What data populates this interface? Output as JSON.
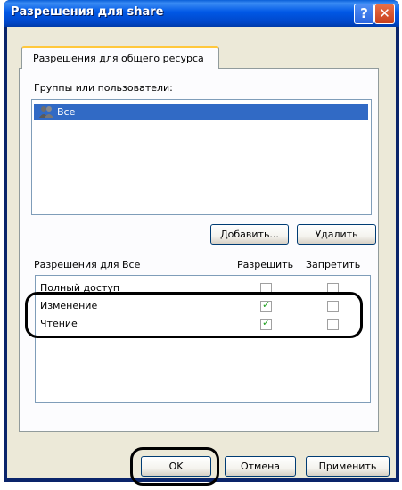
{
  "window": {
    "title": "Разрешения для share"
  },
  "tabs": [
    {
      "label": "Разрешения для общего ресурса"
    }
  ],
  "groups": {
    "label": "Группы или пользователи:",
    "items": [
      {
        "name": "Все",
        "selected": true
      }
    ],
    "add_button": "Добавить...",
    "remove_button": "Удалить"
  },
  "permissions": {
    "label": "Разрешения для Все",
    "allow_header": "Разрешить",
    "deny_header": "Запретить",
    "rows": [
      {
        "name": "Полный доступ",
        "allow": false,
        "deny": false
      },
      {
        "name": "Изменение",
        "allow": true,
        "deny": false
      },
      {
        "name": "Чтение",
        "allow": true,
        "deny": false
      }
    ]
  },
  "footer": {
    "ok": "OK",
    "cancel": "Отмена",
    "apply": "Применить"
  }
}
